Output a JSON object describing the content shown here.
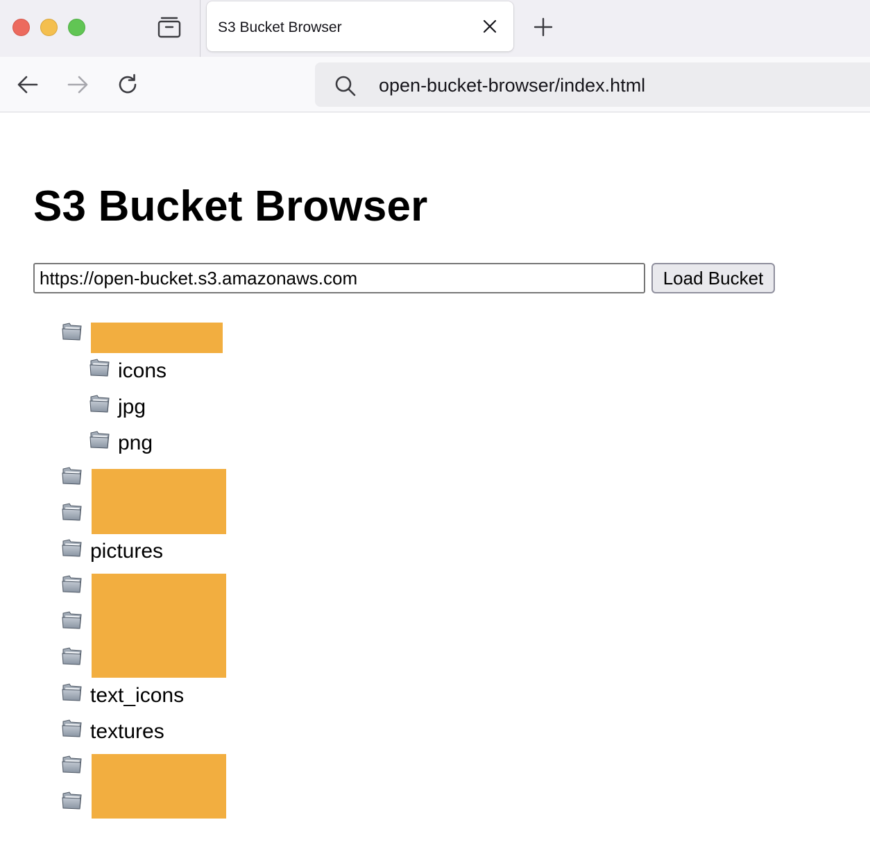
{
  "browser": {
    "tab_title": "S3 Bucket Browser",
    "url": "open-bucket-browser/index.html"
  },
  "page": {
    "title": "S3 Bucket Browser",
    "bucket_url_value": "https://open-bucket.s3.amazonaws.com",
    "load_button_label": "Load Bucket"
  },
  "tree": {
    "rows": [
      {
        "label": "",
        "redacted": true
      },
      {
        "label": "icons"
      },
      {
        "label": "jpg"
      },
      {
        "label": "png"
      },
      {
        "label": "",
        "redacted": true
      },
      {
        "label": "",
        "redacted": true
      },
      {
        "label": "pictures"
      },
      {
        "label": "",
        "redacted": true
      },
      {
        "label": "",
        "redacted": true
      },
      {
        "label": "",
        "redacted": true
      },
      {
        "label": "text_icons"
      },
      {
        "label": "textures"
      },
      {
        "label": "",
        "redacted": true
      },
      {
        "label": "",
        "redacted": true
      }
    ]
  },
  "colors": {
    "redaction": "#f2ae40",
    "folder": "#8a95a3"
  },
  "icons": {
    "folder": "folder-icon"
  }
}
